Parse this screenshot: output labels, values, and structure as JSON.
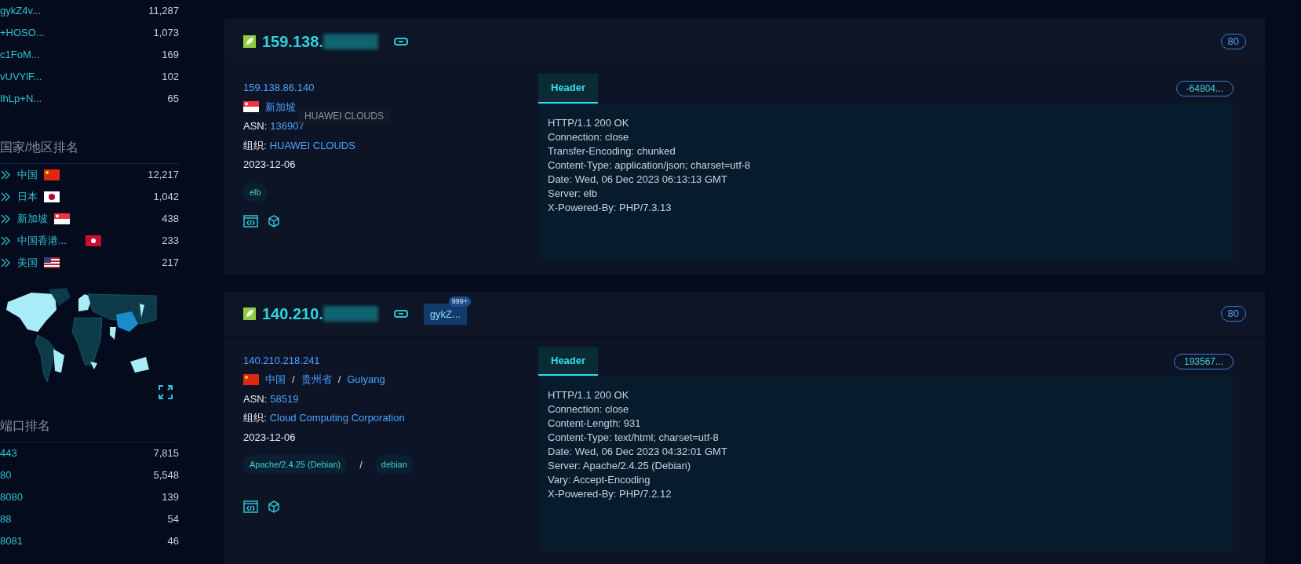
{
  "sidebar": {
    "top_list": [
      {
        "label": "gykZ4v...",
        "count": "11,287"
      },
      {
        "label": "+HOSO...",
        "count": "1,073"
      },
      {
        "label": "c1FoM...",
        "count": "169"
      },
      {
        "label": "vUVYlF...",
        "count": "102"
      },
      {
        "label": "IhLp+N...",
        "count": "65"
      }
    ],
    "country_title": "国家/地区排名",
    "countries": [
      {
        "name": "中国",
        "flag": {
          "kind": "cn"
        },
        "count": "12,217"
      },
      {
        "name": "日本",
        "flag": {
          "kind": "jp"
        },
        "count": "1,042"
      },
      {
        "name": "新加坡",
        "flag": {
          "kind": "sg"
        },
        "count": "438"
      },
      {
        "name": "中国香港...",
        "flag": {
          "kind": "hk"
        },
        "count": "233"
      },
      {
        "name": "美国",
        "flag": {
          "kind": "us"
        },
        "count": "217"
      }
    ],
    "port_title": "端口排名",
    "ports": [
      {
        "port": "443",
        "count": "7,815"
      },
      {
        "port": "80",
        "count": "5,548"
      },
      {
        "port": "8080",
        "count": "139"
      },
      {
        "port": "88",
        "count": "54"
      },
      {
        "port": "8081",
        "count": "46"
      }
    ]
  },
  "results": [
    {
      "title": "159.138.",
      "port": "80",
      "ip": "159.138.86.140",
      "flag": {
        "kind": "sg"
      },
      "location": [
        "新加坡"
      ],
      "asn_label": "ASN:",
      "asn": "136907",
      "org_label": "组织:",
      "org": "HUAWEI CLOUDS",
      "date": "2023-12-06",
      "products": [
        "elb"
      ],
      "tooltip": "HUAWEI CLOUDS",
      "tab": {
        "label": "Header",
        "selected": true
      },
      "hash": "-64804...",
      "header_lines": [
        "HTTP/1.1 200 OK",
        "Connection: close",
        "Transfer-Encoding: chunked",
        "Content-Type: application/json; charset=utf-8",
        "Date: Wed, 06 Dec 2023 06:13:13 GMT",
        "Server: elb",
        "X-Powered-By: PHP/7.3.13"
      ]
    },
    {
      "title": "140.210.",
      "port": "80",
      "tag": {
        "label": "gykZ...",
        "badge": "999+"
      },
      "ip": "140.210.218.241",
      "flag": {
        "kind": "cn"
      },
      "location": [
        "中国",
        "贵州省",
        "Guiyang"
      ],
      "separators": [
        "/",
        "/"
      ],
      "asn_label": "ASN:",
      "asn": "58519",
      "org_label": "组织:",
      "org": "Cloud Computing Corporation",
      "date": "2023-12-06",
      "products": [
        "Apache/2.4.25 (Debian)",
        "debian"
      ],
      "product_separators": [
        "/"
      ],
      "tab": {
        "label": "Header",
        "selected": true
      },
      "hash": "193567...",
      "header_lines": [
        "HTTP/1.1 200 OK",
        "Connection: close",
        "Content-Length: 931",
        "Content-Type: text/html; charset=utf-8",
        "Date: Wed, 06 Dec 2023 04:32:01 GMT",
        "Server: Apache/2.4.25 (Debian)",
        "Vary: Accept-Encoding",
        "X-Powered-By: PHP/7.2.12"
      ]
    }
  ]
}
